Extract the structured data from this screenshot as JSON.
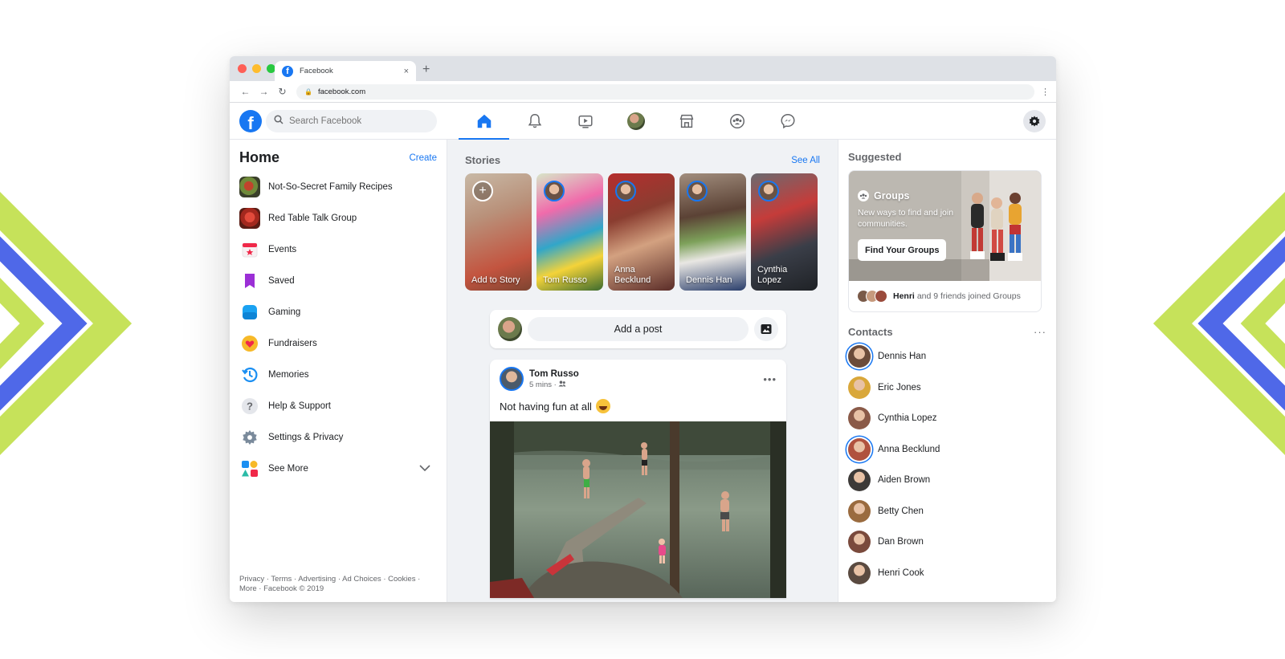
{
  "browser": {
    "tab_title": "Facebook",
    "new_tab": "+",
    "tab_close": "×",
    "url": "facebook.com"
  },
  "header": {
    "search_placeholder": "Search Facebook",
    "nav": [
      "home",
      "notifications",
      "watch",
      "profile",
      "marketplace",
      "groups",
      "messenger"
    ],
    "active_nav": "home"
  },
  "left": {
    "title": "Home",
    "create": "Create",
    "items": [
      {
        "label": "Not-So-Secret Family Recipes",
        "icon": "group-photo-icon"
      },
      {
        "label": "Red Table Talk Group",
        "icon": "group-photo-icon"
      },
      {
        "label": "Events",
        "icon": "calendar-icon"
      },
      {
        "label": "Saved",
        "icon": "bookmark-icon"
      },
      {
        "label": "Gaming",
        "icon": "gaming-icon"
      },
      {
        "label": "Fundraisers",
        "icon": "heart-icon"
      },
      {
        "label": "Memories",
        "icon": "clock-icon"
      },
      {
        "label": "Help & Support",
        "icon": "question-icon"
      },
      {
        "label": "Settings & Privacy",
        "icon": "gear-icon"
      },
      {
        "label": "See More",
        "icon": "shapes-icon"
      }
    ],
    "footer": "Privacy · Terms · Advertising · Ad Choices · Cookies · More · Facebook © 2019"
  },
  "stories": {
    "title": "Stories",
    "see_all": "See All",
    "items": [
      {
        "name": "Add to Story"
      },
      {
        "name": "Tom Russo"
      },
      {
        "name": "Anna Becklund"
      },
      {
        "name": "Dennis Han"
      },
      {
        "name": "Cynthia Lopez"
      }
    ]
  },
  "composer": {
    "placeholder": "Add a post"
  },
  "post": {
    "author": "Tom Russo",
    "time": "5 mins · ",
    "text": "Not having fun at all"
  },
  "suggested": {
    "title": "Suggested",
    "card_title": "Groups",
    "card_sub": "New ways to find and join communities.",
    "button": "Find Your Groups",
    "footer_name": "Henri",
    "footer_text": "and 9 friends joined Groups"
  },
  "contacts": {
    "title": "Contacts",
    "more": "···",
    "items": [
      {
        "name": "Dennis Han",
        "color": "#6b4b3a",
        "ring": true
      },
      {
        "name": "Eric Jones",
        "color": "#d9a73a",
        "ring": false
      },
      {
        "name": "Cynthia Lopez",
        "color": "#8a5a48",
        "ring": false
      },
      {
        "name": "Anna Becklund",
        "color": "#b0523e",
        "ring": true
      },
      {
        "name": "Aiden Brown",
        "color": "#3d3a38",
        "ring": false
      },
      {
        "name": "Betty Chen",
        "color": "#9a6b3f",
        "ring": false
      },
      {
        "name": "Dan Brown",
        "color": "#7a4a3c",
        "ring": false
      },
      {
        "name": "Henri Cook",
        "color": "#5a4a40",
        "ring": false
      }
    ]
  },
  "colors": {
    "brand": "#1877f2",
    "deco_green": "#c6e25a",
    "deco_blue": "#4f68e8"
  }
}
